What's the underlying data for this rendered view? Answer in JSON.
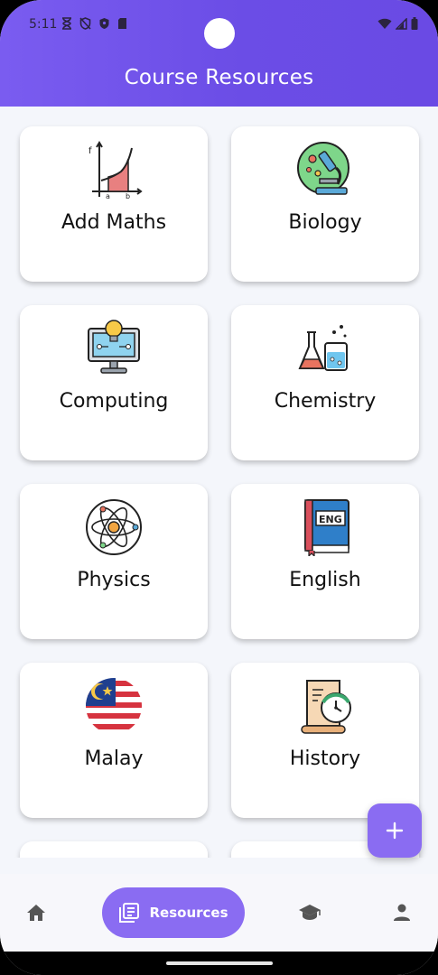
{
  "status_bar": {
    "time": "5:11",
    "icons_left": [
      "hourglass-icon",
      "shield-off-icon",
      "shield-icon",
      "sim-card-icon"
    ],
    "icons_right": [
      "wifi-icon",
      "signal-icon",
      "battery-icon"
    ]
  },
  "header": {
    "title": "Course Resources",
    "gradient": [
      "#7a5cf0",
      "#6a4ae4"
    ]
  },
  "courses": [
    {
      "label": "Add Maths",
      "icon": "integral-graph-icon"
    },
    {
      "label": "Biology",
      "icon": "microscope-icon"
    },
    {
      "label": "Computing",
      "icon": "computer-idea-icon"
    },
    {
      "label": "Chemistry",
      "icon": "lab-flasks-icon"
    },
    {
      "label": "Physics",
      "icon": "atom-icon"
    },
    {
      "label": "English",
      "icon": "eng-book-icon"
    },
    {
      "label": "Malay",
      "icon": "malaysia-flag-icon"
    },
    {
      "label": "History",
      "icon": "scroll-clock-icon"
    }
  ],
  "fab": {
    "label": "+",
    "color": "#8a6cf2"
  },
  "bottom_nav": {
    "items": [
      {
        "name": "home",
        "icon": "home-icon"
      },
      {
        "name": "resources",
        "label": "Resources",
        "icon": "library-books-icon",
        "active": true
      },
      {
        "name": "courses",
        "icon": "graduation-cap-icon"
      },
      {
        "name": "profile",
        "icon": "person-icon"
      }
    ],
    "accent": "#8a6cf2"
  }
}
